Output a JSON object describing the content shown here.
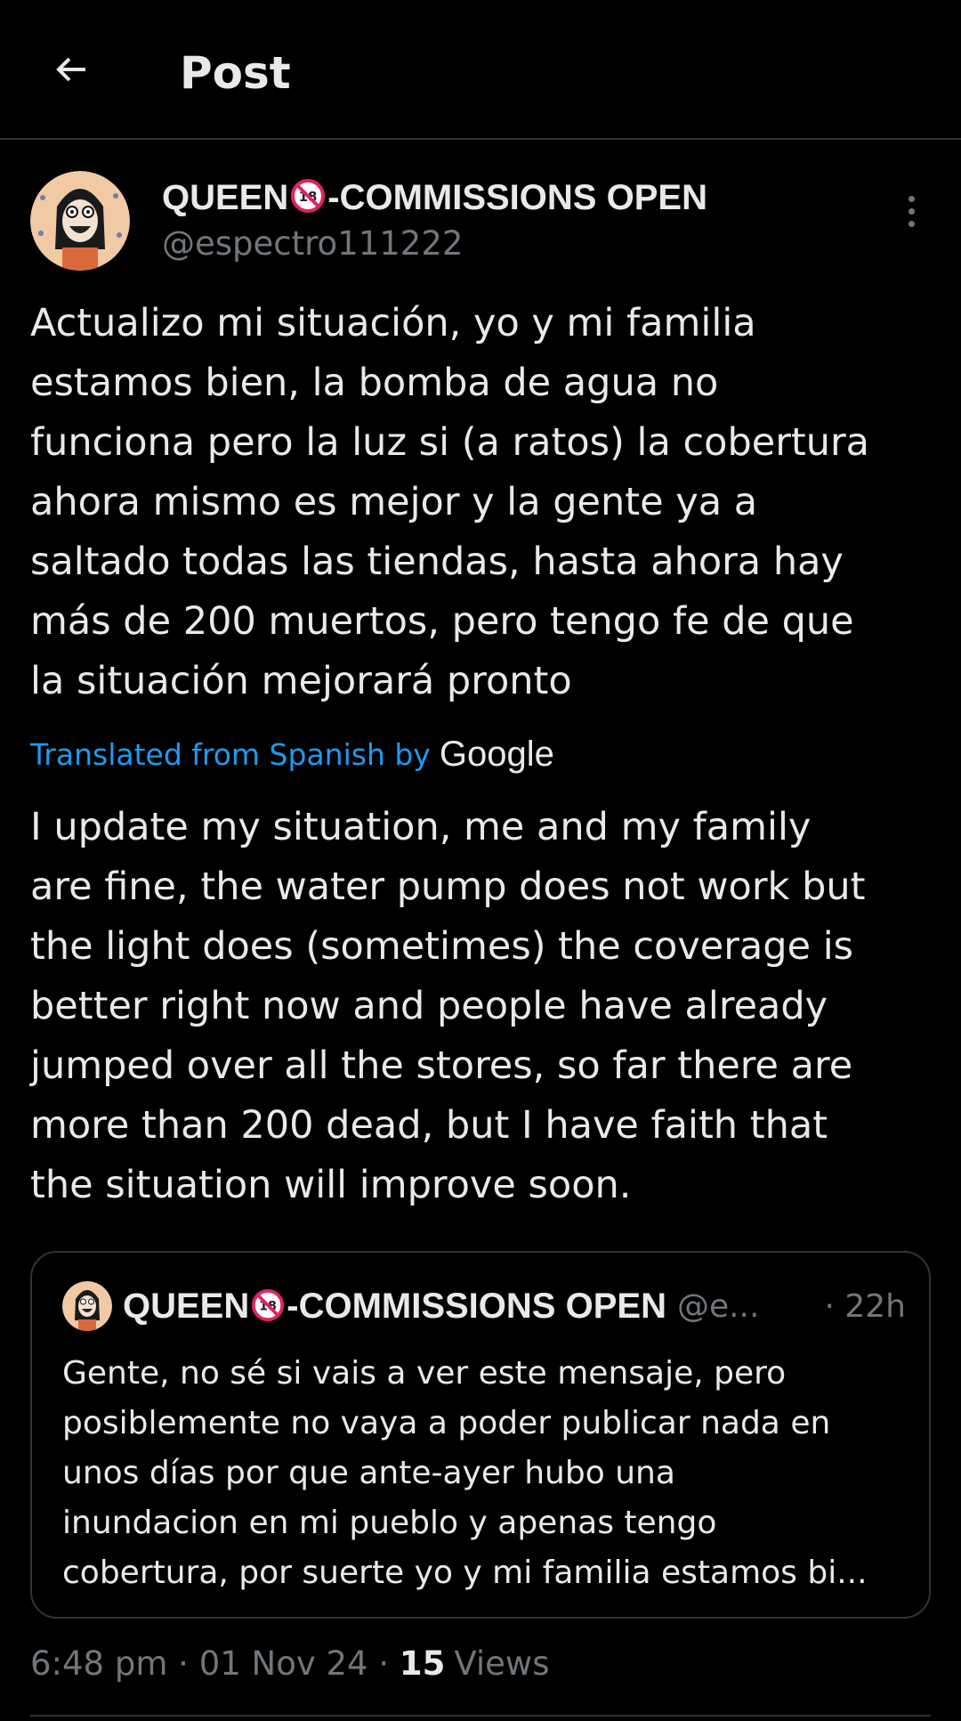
{
  "header": {
    "title": "Post"
  },
  "author": {
    "name_prefix": "QUEEN",
    "badge": "18",
    "name_suffix": "-COMMISSIONS OPEN",
    "handle": "@espectro111222"
  },
  "post": {
    "original_lines": [
      "Actualizo mi situación, yo y mi familia",
      "estamos bien, la bomba de agua no",
      "funciona pero la luz si (a ratos) la cobertura",
      "ahora mismo es mejor y la gente ya a",
      "saltado todas las tiendas, hasta ahora hay",
      "más de 200 muertos, pero tengo fe de que",
      "la situación mejorará pronto"
    ],
    "translated_label": "Translated from Spanish by",
    "translator": "Google",
    "translated_lines": [
      "I update my situation, me and my family",
      "are fine, the water pump does not work but",
      "the light does (sometimes) the coverage is",
      "better right now and people have already",
      "jumped over all the stores, so far there are",
      "more than 200 dead, but I have faith that",
      "the situation will improve soon."
    ]
  },
  "quote": {
    "name_prefix": "QUEEN",
    "badge": "18",
    "name_suffix": "-COMMISSIONS OPEN",
    "handle": "@e...",
    "time": "· 22h",
    "lines": [
      "Gente, no sé si vais a ver este mensaje, pero",
      "posiblemente no vaya a poder publicar nada en",
      "unos días por que ante-ayer hubo una",
      "inundacion en mi pueblo y apenas tengo",
      "cobertura, por suerte yo y mi familia estamos bi..."
    ]
  },
  "meta": {
    "time": "6:48 pm",
    "sep1": " · ",
    "date": "01 Nov 24",
    "sep2": " · ",
    "views_count": "15",
    "views_label": "Views"
  },
  "colors": {
    "background": "#000000",
    "text": "#e7e9ea",
    "secondary": "#71767b",
    "link": "#1d9bf0",
    "divider": "#2f3336",
    "badge_red": "#e0245e"
  }
}
